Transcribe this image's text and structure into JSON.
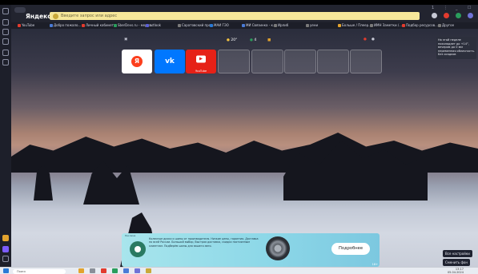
{
  "browser": {
    "logo": "Яндекс",
    "address_placeholder": "Введите запрос или адрес",
    "address_right": "",
    "window_controls": [
      "1",
      "⋮",
      "_",
      "☐"
    ]
  },
  "bookmarks": [
    {
      "label": "YouTube",
      "color": "#e23b2e"
    },
    {
      "label": "Добро пожало...",
      "color": "#4a7bd6"
    },
    {
      "label": "Личный кабинет",
      "color": "#e23b2e"
    },
    {
      "label": "SberDevs.ru - мероп...",
      "color": "#2a9d5c"
    },
    {
      "label": "artlook",
      "color": "#5b5fd6"
    },
    {
      "label": "Саратовский про...",
      "color": "#7a7a7a"
    },
    {
      "label": "МАИ ГЭО",
      "color": "#2a7ad6"
    },
    {
      "label": "МИ Связинка - к...",
      "color": "#4a7bd6"
    },
    {
      "label": "Ирлиб",
      "color": "#7a7a7a"
    },
    {
      "label": "уени",
      "color": "#7a7a7a"
    },
    {
      "label": "Больше / Плеер...",
      "color": "#e2a32e"
    },
    {
      "label": "ИМН Заметки /...",
      "color": "#7a7a7a"
    },
    {
      "label": "Подбор ресурсов...",
      "color": "#e23b2e"
    },
    {
      "label": "Другое",
      "color": "#7a7a7a"
    }
  ],
  "widgets": {
    "weather": "20°",
    "traffic": "4",
    "mail": ""
  },
  "speed_dial": [
    {
      "label": "",
      "kind": "yandex",
      "color": "#ffffff"
    },
    {
      "label": "",
      "kind": "vk",
      "color": "#0077ff"
    },
    {
      "label": "YouTube",
      "kind": "youtube",
      "color": "#e62117"
    },
    {
      "label": "",
      "kind": "empty"
    },
    {
      "label": "",
      "kind": "empty"
    },
    {
      "label": "",
      "kind": "empty"
    },
    {
      "label": "",
      "kind": "empty"
    },
    {
      "label": "",
      "kind": "empty"
    }
  ],
  "tooltip": [
    "На этой неделе",
    "похолодает до +14°,",
    "вечером до 0 мм",
    "переменная облачность.",
    "Без осадков"
  ],
  "ad": {
    "tag": "Реклама",
    "text": "Колесные диски и шины от производителя. Низкие цены, гарантия. Доставка по всей России. Большой выбор, быстрая доставка, скидки постоянным клиентам. Подберём шины для вашего авто.",
    "button": "Подробнее",
    "mark": "18+"
  },
  "bottom_right_buttons": [
    "Все настройки",
    "Сменить фон"
  ],
  "taskbar": {
    "search": "Поиск",
    "time": "13:17",
    "date": "05.04.2024"
  }
}
